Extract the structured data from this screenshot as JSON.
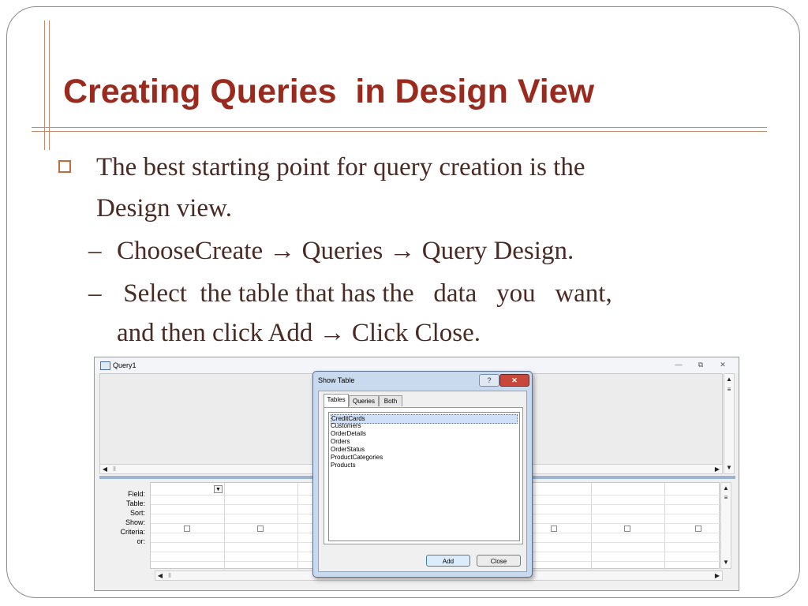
{
  "slide": {
    "title": "Creating Queries  in Design View",
    "bullets": [
      "The best starting point for query creation is the",
      "Design view."
    ],
    "sub1": "ChooseCreate → Queries → Query Design.",
    "sub2_line1": " Select  the table that has the   data   you   want,",
    "sub2_line2": "and then click Add → Click Close.",
    "dash": "–"
  },
  "access_window": {
    "title": "Query1",
    "minimize": "—",
    "restore": "⧉",
    "close": "✕",
    "row_labels": [
      "Field:",
      "Table:",
      "Sort:",
      "Show:",
      "Criteria:",
      "or:"
    ]
  },
  "dialog": {
    "title": "Show Table",
    "help": "?",
    "close": "✕",
    "tabs": [
      "Tables",
      "Queries",
      "Both"
    ],
    "tables": [
      "CreditCards",
      "Customers",
      "OrderDetails",
      "Orders",
      "OrderStatus",
      "ProductCategories",
      "Products"
    ],
    "add_label": "Add",
    "close_label": "Close"
  },
  "colors": {
    "title": "#9b2a1e",
    "body_text": "#4a2a22",
    "rule": "#c8896a",
    "selection": "#cfe0f8"
  },
  "icons": {
    "bullet": "hollow-square-icon",
    "window": "query-window-icon"
  }
}
